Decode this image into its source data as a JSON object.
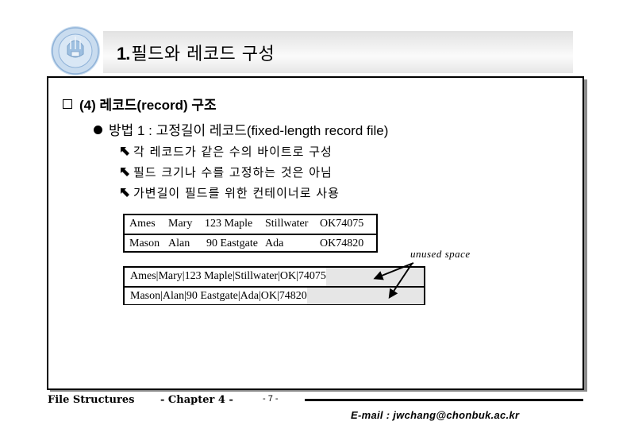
{
  "header": {
    "logo": "university-seal-icon",
    "title_number": "1.",
    "title_text": "필드와 레코드 구성"
  },
  "content": {
    "heading": {
      "icon": "checkbox-square-icon",
      "text": "(4) 레코드(record) 구조"
    },
    "method": {
      "icon": "filled-circle-bullet-icon",
      "text": "방법 1 : 고정길이 레코드(fixed-length record file)"
    },
    "sub_items": [
      {
        "icon": "arrow-up-left-icon",
        "text": "각 레코드가 같은 수의 바이트로 구성"
      },
      {
        "icon": "arrow-up-left-icon",
        "text": "필드 크기나 수를 고정하는 것은 아님"
      },
      {
        "icon": "arrow-up-left-icon",
        "text": "가변길이 필드를 위한 컨테이너로 사용"
      }
    ],
    "fixed_fields_table": {
      "rows": [
        [
          "Ames",
          "Mary",
          "123 Maple",
          "Stillwater",
          "OK74075"
        ],
        [
          "Mason",
          "Alan",
          "90 Eastgate",
          "Ada",
          "OK74820"
        ]
      ]
    },
    "delimited_records_table": {
      "rows": [
        "Ames|Mary|123 Maple|Stillwater|OK|74075",
        "Mason|Alan|90 Eastgate|Ada|OK|74820"
      ],
      "annotation": "unused space"
    }
  },
  "footer": {
    "course": "File Structures",
    "chapter": "- Chapter 4 -",
    "page": "- 7 -",
    "email": "E-mail : jwchang@chonbuk.ac.kr"
  }
}
